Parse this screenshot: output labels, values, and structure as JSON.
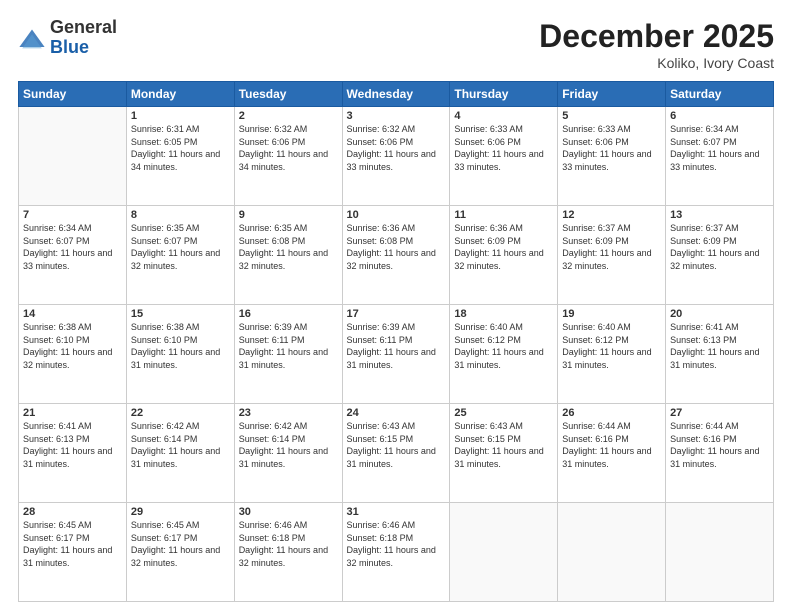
{
  "header": {
    "logo_general": "General",
    "logo_blue": "Blue",
    "month_year": "December 2025",
    "location": "Koliko, Ivory Coast"
  },
  "weekdays": [
    "Sunday",
    "Monday",
    "Tuesday",
    "Wednesday",
    "Thursday",
    "Friday",
    "Saturday"
  ],
  "weeks": [
    [
      {
        "day": "",
        "empty": true
      },
      {
        "day": "1",
        "sunrise": "Sunrise: 6:31 AM",
        "sunset": "Sunset: 6:05 PM",
        "daylight": "Daylight: 11 hours and 34 minutes."
      },
      {
        "day": "2",
        "sunrise": "Sunrise: 6:32 AM",
        "sunset": "Sunset: 6:06 PM",
        "daylight": "Daylight: 11 hours and 34 minutes."
      },
      {
        "day": "3",
        "sunrise": "Sunrise: 6:32 AM",
        "sunset": "Sunset: 6:06 PM",
        "daylight": "Daylight: 11 hours and 33 minutes."
      },
      {
        "day": "4",
        "sunrise": "Sunrise: 6:33 AM",
        "sunset": "Sunset: 6:06 PM",
        "daylight": "Daylight: 11 hours and 33 minutes."
      },
      {
        "day": "5",
        "sunrise": "Sunrise: 6:33 AM",
        "sunset": "Sunset: 6:06 PM",
        "daylight": "Daylight: 11 hours and 33 minutes."
      },
      {
        "day": "6",
        "sunrise": "Sunrise: 6:34 AM",
        "sunset": "Sunset: 6:07 PM",
        "daylight": "Daylight: 11 hours and 33 minutes."
      }
    ],
    [
      {
        "day": "7",
        "sunrise": "Sunrise: 6:34 AM",
        "sunset": "Sunset: 6:07 PM",
        "daylight": "Daylight: 11 hours and 33 minutes."
      },
      {
        "day": "8",
        "sunrise": "Sunrise: 6:35 AM",
        "sunset": "Sunset: 6:07 PM",
        "daylight": "Daylight: 11 hours and 32 minutes."
      },
      {
        "day": "9",
        "sunrise": "Sunrise: 6:35 AM",
        "sunset": "Sunset: 6:08 PM",
        "daylight": "Daylight: 11 hours and 32 minutes."
      },
      {
        "day": "10",
        "sunrise": "Sunrise: 6:36 AM",
        "sunset": "Sunset: 6:08 PM",
        "daylight": "Daylight: 11 hours and 32 minutes."
      },
      {
        "day": "11",
        "sunrise": "Sunrise: 6:36 AM",
        "sunset": "Sunset: 6:09 PM",
        "daylight": "Daylight: 11 hours and 32 minutes."
      },
      {
        "day": "12",
        "sunrise": "Sunrise: 6:37 AM",
        "sunset": "Sunset: 6:09 PM",
        "daylight": "Daylight: 11 hours and 32 minutes."
      },
      {
        "day": "13",
        "sunrise": "Sunrise: 6:37 AM",
        "sunset": "Sunset: 6:09 PM",
        "daylight": "Daylight: 11 hours and 32 minutes."
      }
    ],
    [
      {
        "day": "14",
        "sunrise": "Sunrise: 6:38 AM",
        "sunset": "Sunset: 6:10 PM",
        "daylight": "Daylight: 11 hours and 32 minutes."
      },
      {
        "day": "15",
        "sunrise": "Sunrise: 6:38 AM",
        "sunset": "Sunset: 6:10 PM",
        "daylight": "Daylight: 11 hours and 31 minutes."
      },
      {
        "day": "16",
        "sunrise": "Sunrise: 6:39 AM",
        "sunset": "Sunset: 6:11 PM",
        "daylight": "Daylight: 11 hours and 31 minutes."
      },
      {
        "day": "17",
        "sunrise": "Sunrise: 6:39 AM",
        "sunset": "Sunset: 6:11 PM",
        "daylight": "Daylight: 11 hours and 31 minutes."
      },
      {
        "day": "18",
        "sunrise": "Sunrise: 6:40 AM",
        "sunset": "Sunset: 6:12 PM",
        "daylight": "Daylight: 11 hours and 31 minutes."
      },
      {
        "day": "19",
        "sunrise": "Sunrise: 6:40 AM",
        "sunset": "Sunset: 6:12 PM",
        "daylight": "Daylight: 11 hours and 31 minutes."
      },
      {
        "day": "20",
        "sunrise": "Sunrise: 6:41 AM",
        "sunset": "Sunset: 6:13 PM",
        "daylight": "Daylight: 11 hours and 31 minutes."
      }
    ],
    [
      {
        "day": "21",
        "sunrise": "Sunrise: 6:41 AM",
        "sunset": "Sunset: 6:13 PM",
        "daylight": "Daylight: 11 hours and 31 minutes."
      },
      {
        "day": "22",
        "sunrise": "Sunrise: 6:42 AM",
        "sunset": "Sunset: 6:14 PM",
        "daylight": "Daylight: 11 hours and 31 minutes."
      },
      {
        "day": "23",
        "sunrise": "Sunrise: 6:42 AM",
        "sunset": "Sunset: 6:14 PM",
        "daylight": "Daylight: 11 hours and 31 minutes."
      },
      {
        "day": "24",
        "sunrise": "Sunrise: 6:43 AM",
        "sunset": "Sunset: 6:15 PM",
        "daylight": "Daylight: 11 hours and 31 minutes."
      },
      {
        "day": "25",
        "sunrise": "Sunrise: 6:43 AM",
        "sunset": "Sunset: 6:15 PM",
        "daylight": "Daylight: 11 hours and 31 minutes."
      },
      {
        "day": "26",
        "sunrise": "Sunrise: 6:44 AM",
        "sunset": "Sunset: 6:16 PM",
        "daylight": "Daylight: 11 hours and 31 minutes."
      },
      {
        "day": "27",
        "sunrise": "Sunrise: 6:44 AM",
        "sunset": "Sunset: 6:16 PM",
        "daylight": "Daylight: 11 hours and 31 minutes."
      }
    ],
    [
      {
        "day": "28",
        "sunrise": "Sunrise: 6:45 AM",
        "sunset": "Sunset: 6:17 PM",
        "daylight": "Daylight: 11 hours and 31 minutes."
      },
      {
        "day": "29",
        "sunrise": "Sunrise: 6:45 AM",
        "sunset": "Sunset: 6:17 PM",
        "daylight": "Daylight: 11 hours and 32 minutes."
      },
      {
        "day": "30",
        "sunrise": "Sunrise: 6:46 AM",
        "sunset": "Sunset: 6:18 PM",
        "daylight": "Daylight: 11 hours and 32 minutes."
      },
      {
        "day": "31",
        "sunrise": "Sunrise: 6:46 AM",
        "sunset": "Sunset: 6:18 PM",
        "daylight": "Daylight: 11 hours and 32 minutes."
      },
      {
        "day": "",
        "empty": true
      },
      {
        "day": "",
        "empty": true
      },
      {
        "day": "",
        "empty": true
      }
    ]
  ]
}
